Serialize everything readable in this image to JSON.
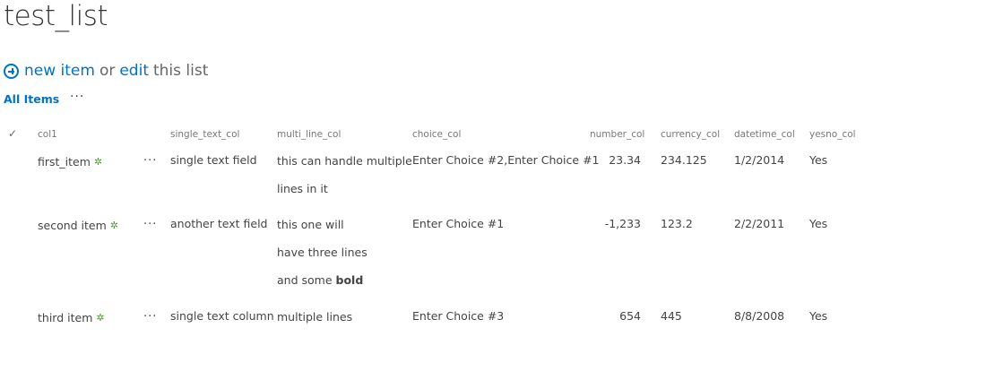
{
  "page": {
    "title": "test_list",
    "new_item_label": "new item",
    "or_label": "or",
    "edit_label": "edit",
    "this_list_label": "this list",
    "view_name": "All Items",
    "more_label": "···"
  },
  "columns": {
    "check": "✓",
    "col1": "col1",
    "single_text_col": "single_text_col",
    "multi_line_col": "multi_line_col",
    "choice_col": "choice_col",
    "number_col": "number_col",
    "currency_col": "currency_col",
    "datetime_col": "datetime_col",
    "yesno_col": "yesno_col"
  },
  "rows": [
    {
      "col1": "first_item",
      "new_marker": "✲",
      "single_text": "single text field",
      "multi_line": [
        "this can handle multiple",
        "lines in it"
      ],
      "choice": "Enter Choice #2,Enter Choice #1",
      "number": "23.34",
      "currency": "234.125",
      "datetime": "1/2/2014",
      "yesno": "Yes"
    },
    {
      "col1": "second item",
      "new_marker": "✲",
      "single_text": "another text field",
      "multi_line": [
        "this one will",
        "have three lines",
        "and some"
      ],
      "multi_line_bold": "bold",
      "choice": "Enter Choice #1",
      "number": "-1,233",
      "currency": "123.2",
      "datetime": "2/2/2011",
      "yesno": "Yes"
    },
    {
      "col1": "third item",
      "new_marker": "✲",
      "single_text": "single text column",
      "multi_line": [
        "multiple lines"
      ],
      "choice": "Enter Choice #3",
      "number": "654",
      "currency": "445",
      "datetime": "8/8/2008",
      "yesno": "Yes"
    }
  ],
  "icons": {
    "new_item": "plus-circle-icon",
    "new_marker": "new-star-icon"
  },
  "colors": {
    "link": "#0072c6",
    "new_marker": "#4a9e2f"
  }
}
